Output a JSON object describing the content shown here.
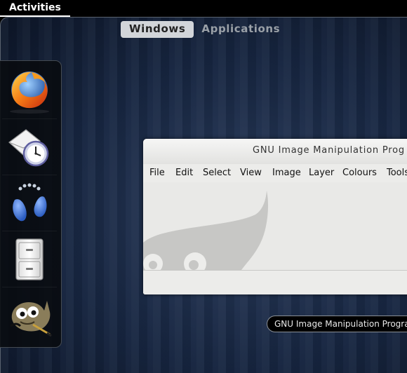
{
  "topbar": {
    "activities_label": "Activities"
  },
  "view_tabs": {
    "windows": "Windows",
    "applications": "Applications"
  },
  "dash": {
    "items": [
      {
        "icon": "firefox-icon",
        "app": "Firefox"
      },
      {
        "icon": "mail-clock-icon",
        "app": "Evolution"
      },
      {
        "icon": "footprints-icon",
        "app": "Help"
      },
      {
        "icon": "file-cabinet-icon",
        "app": "Files"
      },
      {
        "icon": "gimp-icon",
        "app": "GIMP"
      }
    ]
  },
  "window": {
    "title": "GNU Image Manipulation Prog",
    "menu": [
      "File",
      "Edit",
      "Select",
      "View",
      "Image",
      "Layer",
      "Colours",
      "Tools"
    ]
  },
  "tooltip": {
    "text": "GNU Image Manipulation Program"
  },
  "colors": {
    "background": "#172641",
    "panel": "#000000",
    "tab_active": "#d2d5d9"
  }
}
